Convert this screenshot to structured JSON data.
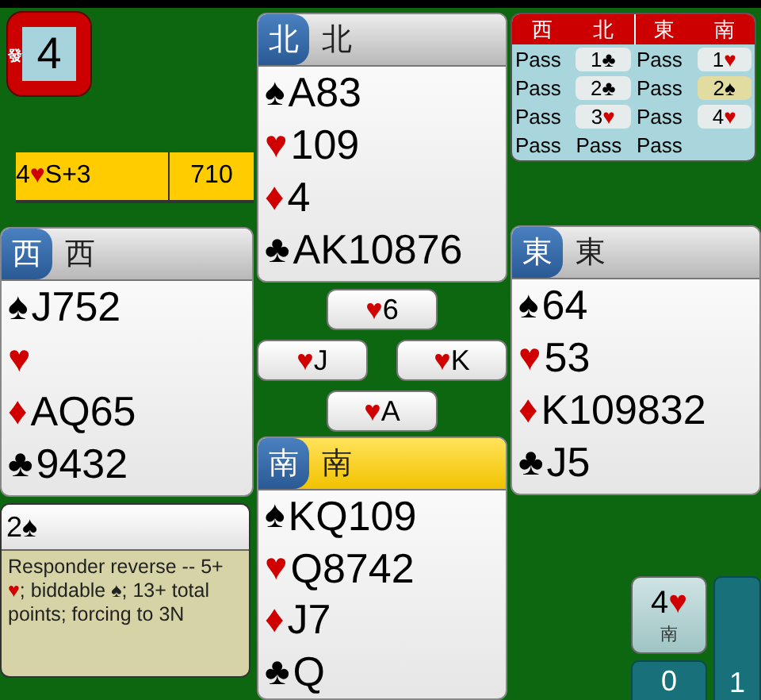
{
  "board": {
    "number": "4",
    "dealer": "發",
    "ns_vulnerable": true,
    "ew_vulnerable": true
  },
  "result": {
    "contract": "4",
    "suit": "♥",
    "red": true,
    "declarer_result": "S+3",
    "score": "710"
  },
  "hands": {
    "north": {
      "badge": "北",
      "name": "北",
      "highlighted": false,
      "suits": [
        {
          "kind": "spades",
          "symbol": "♠",
          "cards": "A83"
        },
        {
          "kind": "hearts",
          "symbol": "♥",
          "cards": "109"
        },
        {
          "kind": "diamonds",
          "symbol": "♦",
          "cards": "4"
        },
        {
          "kind": "clubs",
          "symbol": "♣",
          "cards": "AK10876"
        }
      ]
    },
    "west": {
      "badge": "西",
      "name": "西",
      "highlighted": false,
      "suits": [
        {
          "kind": "spades",
          "symbol": "♠",
          "cards": "J752"
        },
        {
          "kind": "hearts",
          "symbol": "♥"
        },
        {
          "kind": "diamonds",
          "symbol": "♦",
          "cards": "AQ65"
        },
        {
          "kind": "clubs",
          "symbol": "♣",
          "cards": "9432"
        }
      ]
    },
    "east": {
      "badge": "東",
      "name": "東",
      "highlighted": false,
      "suits": [
        {
          "kind": "spades",
          "symbol": "♠",
          "cards": "64"
        },
        {
          "kind": "hearts",
          "symbol": "♥",
          "cards": "53"
        },
        {
          "kind": "diamonds",
          "symbol": "♦",
          "cards": "K109832"
        },
        {
          "kind": "clubs",
          "symbol": "♣",
          "cards": "J5"
        }
      ]
    },
    "south": {
      "badge": "南",
      "name": "南",
      "highlighted": true,
      "suits": [
        {
          "kind": "spades",
          "symbol": "♠",
          "cards": "KQ109"
        },
        {
          "kind": "hearts",
          "symbol": "♥",
          "cards": "Q8742"
        },
        {
          "kind": "diamonds",
          "symbol": "♦",
          "cards": "J7"
        },
        {
          "kind": "clubs",
          "symbol": "♣",
          "cards": "Q"
        }
      ]
    }
  },
  "trick": {
    "north": {
      "suit": "♥",
      "red": true,
      "rank": "6"
    },
    "west": {
      "suit": "♥",
      "red": true,
      "rank": "J"
    },
    "east": {
      "suit": "♥",
      "red": true,
      "rank": "K"
    },
    "south": {
      "suit": "♥",
      "red": true,
      "rank": "A"
    }
  },
  "auction": {
    "columns": [
      "西",
      "北",
      "東",
      "南"
    ],
    "rows": [
      [
        {
          "kind": "pass",
          "text": "Pass"
        },
        {
          "kind": "bid",
          "rank": "1",
          "suit": "♣",
          "red": false,
          "selected": false
        },
        {
          "kind": "pass",
          "text": "Pass"
        },
        {
          "kind": "bid",
          "rank": "1",
          "suit": "♥",
          "red": true,
          "selected": false
        }
      ],
      [
        {
          "kind": "pass",
          "text": "Pass"
        },
        {
          "kind": "bid",
          "rank": "2",
          "suit": "♣",
          "red": false,
          "selected": false
        },
        {
          "kind": "pass",
          "text": "Pass"
        },
        {
          "kind": "bid",
          "rank": "2",
          "suit": "♠",
          "red": false,
          "selected": true
        }
      ],
      [
        {
          "kind": "pass",
          "text": "Pass"
        },
        {
          "kind": "bid",
          "rank": "3",
          "suit": "♥",
          "red": true,
          "selected": false
        },
        {
          "kind": "pass",
          "text": "Pass"
        },
        {
          "kind": "bid",
          "rank": "4",
          "suit": "♥",
          "red": true,
          "selected": false
        }
      ],
      [
        {
          "kind": "pass",
          "text": "Pass"
        },
        {
          "kind": "pass",
          "text": "Pass"
        },
        {
          "kind": "pass",
          "text": "Pass"
        }
      ]
    ]
  },
  "explanation": {
    "call_rank": "2",
    "call_suit": "♠",
    "call_red": false,
    "segments": [
      {
        "text": "Responder reverse -- 5+ "
      },
      {
        "text": "♥",
        "red": true
      },
      {
        "text": "; biddable "
      },
      {
        "text": "♠"
      },
      {
        "text": "; 13+ total points; forcing to 3N"
      }
    ]
  },
  "final_contract": {
    "rank": "4",
    "suit": "♥",
    "red": true,
    "declarer": "南"
  },
  "tricks": {
    "ns": "1",
    "ew": "0"
  }
}
